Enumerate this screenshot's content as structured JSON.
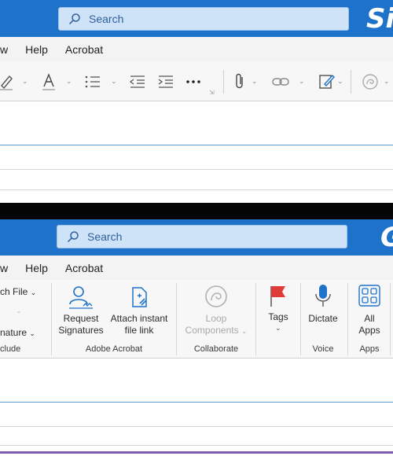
{
  "top": {
    "search_placeholder": "Search",
    "brand_text": "Si",
    "menu": [
      "w",
      "Help",
      "Acrobat"
    ],
    "toolbar_icons": [
      "highlighter-icon",
      "font-color-icon",
      "bullets-icon",
      "decrease-indent-icon",
      "increase-indent-icon",
      "more-icon",
      "attach-icon",
      "link-icon",
      "signature-icon",
      "loop-icon"
    ]
  },
  "bottom": {
    "search_placeholder": "Search",
    "brand_text": "G",
    "menu": [
      "w",
      "Help",
      "Acrobat"
    ],
    "ribbon": {
      "include": {
        "attach_file": "ch File",
        "signature": "nature",
        "group_label": "clude"
      },
      "adobe": {
        "request_signatures": [
          "Request",
          "Signatures"
        ],
        "attach_link": [
          "Attach instant",
          "file link"
        ],
        "group_label": "Adobe Acrobat"
      },
      "collaborate": {
        "loop_components": [
          "Loop",
          "Components"
        ],
        "group_label": "Collaborate"
      },
      "tags": {
        "label": "Tags"
      },
      "voice": {
        "dictate": "Dictate",
        "group_label": "Voice"
      },
      "apps": {
        "all_apps": [
          "All",
          "Apps"
        ],
        "group_label": "Apps"
      }
    }
  },
  "colors": {
    "titlebar": "#1e72c9",
    "accent": "#1e72c9",
    "search_bg": "#cfe3f8",
    "flag": "#e03b3b"
  }
}
